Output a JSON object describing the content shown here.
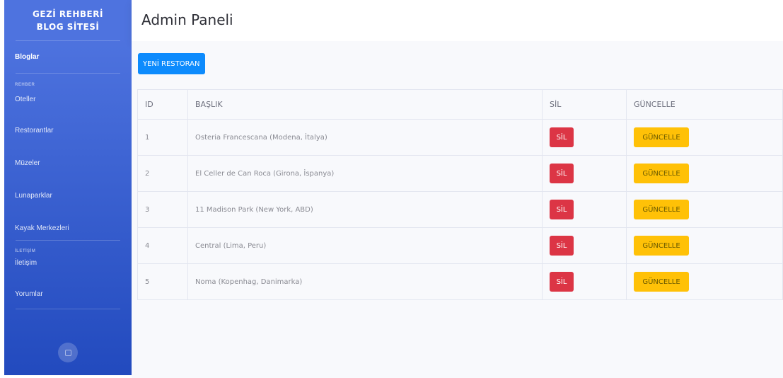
{
  "sidebar": {
    "brand_line1": "GEZİ REHBERİ",
    "brand_line2": "BLOG SİTESİ",
    "blog_label": "Bloglar",
    "heading_rehber": "REHBER",
    "items": [
      {
        "label": "Oteller"
      },
      {
        "label": "Restorantlar"
      },
      {
        "label": "Müzeler"
      },
      {
        "label": "Lunaparklar"
      },
      {
        "label": "Kayak Merkezleri"
      }
    ],
    "heading_iletisim": "İLETİŞİM",
    "contact_items": [
      {
        "label": "İletişim"
      },
      {
        "label": "Yorumlar"
      }
    ]
  },
  "header": {
    "title": "Admin Paneli"
  },
  "toolbar": {
    "new_label": "YENİ RESTORAN"
  },
  "table": {
    "headers": [
      "ID",
      "BAŞLIK",
      "SİL",
      "GÜNCELLE"
    ],
    "delete_label": "SİL",
    "update_label": "GÜNCELLE",
    "rows": [
      {
        "id": "1",
        "title": "Osteria Francescana (Modena, İtalya)"
      },
      {
        "id": "2",
        "title": "El Celler de Can Roca (Girona, İspanya)"
      },
      {
        "id": "3",
        "title": "11 Madison Park (New York, ABD)"
      },
      {
        "id": "4",
        "title": "Central (Lima, Peru)"
      },
      {
        "id": "5",
        "title": "Noma (Kopenhag, Danimarka)"
      }
    ]
  },
  "colors": {
    "sidebar_top": "#4e73df",
    "sidebar_bottom": "#224abe",
    "primary": "#0d8bfd",
    "danger": "#dc3545",
    "warning": "#ffc107"
  }
}
